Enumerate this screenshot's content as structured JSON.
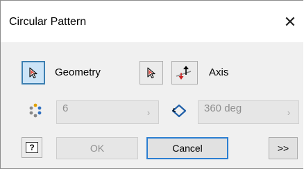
{
  "window": {
    "title": "Circular Pattern",
    "close_glyph": "✕"
  },
  "geometry": {
    "label": "Geometry",
    "select_icon": "select-arrow-icon"
  },
  "axis": {
    "label": "Axis",
    "select_icon": "select-arrow-icon",
    "flip_icon": "flip-direction-icon"
  },
  "count": {
    "icon": "pattern-count-icon",
    "value": "6",
    "chevron": "›"
  },
  "angle": {
    "icon": "rotation-angle-icon",
    "value": "360 deg",
    "chevron": "›"
  },
  "buttons": {
    "help_glyph": "?",
    "ok": "OK",
    "cancel": "Cancel",
    "more": ">>"
  },
  "colors": {
    "accent": "#3399ff",
    "arrow_red": "#cc2222",
    "disabled_text": "#8f8f8f"
  }
}
